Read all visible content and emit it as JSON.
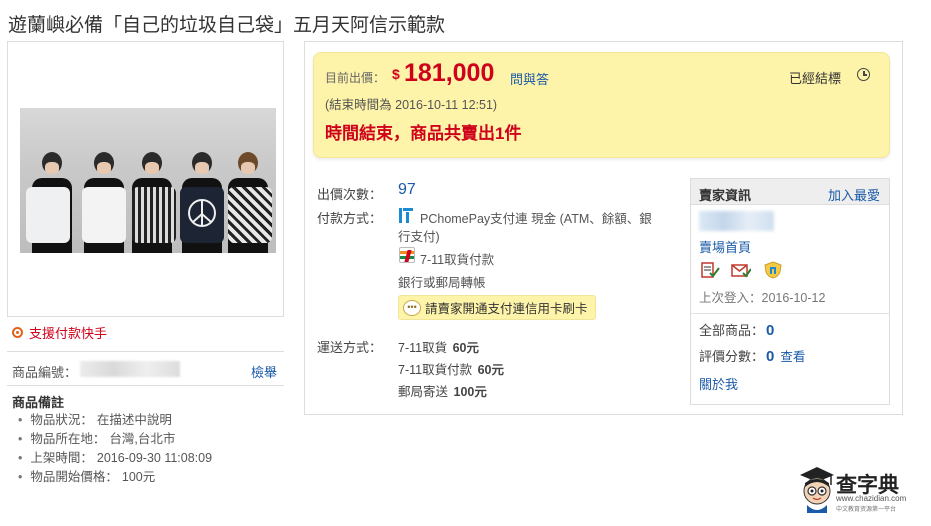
{
  "page": {
    "title": "遊蘭嶼必備「自己的垃圾自己袋」五月天阿信示範款"
  },
  "left": {
    "pay_fast": "支援付款快手",
    "item_no_label": "商品編號：",
    "report": "檢舉",
    "notes_title": "商品備註",
    "notes": [
      {
        "label": "物品狀況：",
        "value": "在描述中說明"
      },
      {
        "label": "物品所在地：",
        "value": "台灣,台北市"
      },
      {
        "label": "上架時間：",
        "value": "2016-09-30  11:08:09"
      },
      {
        "label": "物品開始價格：",
        "value": "100元"
      }
    ]
  },
  "price": {
    "label": "目前出價：",
    "currency": "$",
    "amount": "181,000",
    "qa": "問與答",
    "status": "已經結標",
    "end_time": "(結束時間為 2016-10-11 12:51)",
    "sold_message": "時間結束，商品共賣出1件"
  },
  "details": {
    "bids_label": "出價次數：",
    "bids": "97",
    "payment_label": "付款方式：",
    "payment_line1": "PChomePay支付連 現金 (ATM、餘額、銀",
    "payment_line2": "行支付)",
    "payment_711": "7-11取貨付款",
    "payment_bank": "銀行或郵局轉帳",
    "card_notice": "請賣家開通支付連信用卡刷卡",
    "shipping_label": "運送方式：",
    "shipping": [
      {
        "method": "7-11取貨",
        "fee": "60元"
      },
      {
        "method": "7-11取貨付款",
        "fee": "60元"
      },
      {
        "method": "郵局寄送",
        "fee": "100元"
      }
    ]
  },
  "seller": {
    "title": "賣家資訊",
    "follow": "加入最愛",
    "store": "賣場首頁",
    "last_login": "上次登入：2016-10-12",
    "all_items_label": "全部商品：",
    "all_items": "0",
    "rating_label": "評價分數：",
    "rating": "0",
    "rating_link": "查看",
    "about": "關於我"
  },
  "watermark": {
    "name": "查字典",
    "url": "www.chazidian.com",
    "slogan": "中文教育资源第一平台"
  },
  "colors": {
    "price_red": "#d0021b",
    "link_blue": "#1a5aa8",
    "highlight_yellow": "#fdf3a9"
  }
}
